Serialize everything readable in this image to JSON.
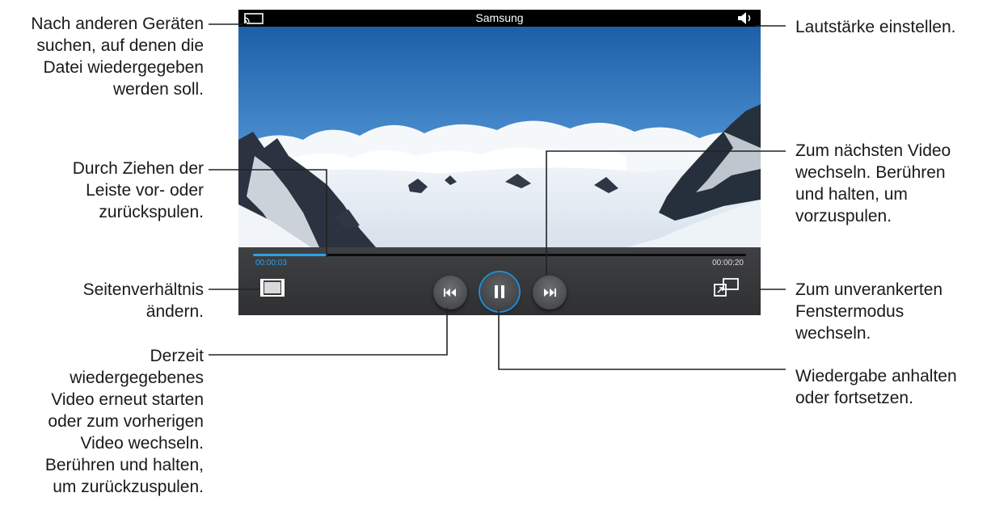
{
  "player": {
    "title": "Samsung",
    "time_current": "00:00:03",
    "time_total": "00:00:20",
    "progress": 0.15,
    "accent_color": "#2aa3e6",
    "icons": {
      "cast": "screen-mirroring-icon",
      "volume": "speaker-icon",
      "aspect": "aspect-ratio-icon",
      "previous": "skip-previous-icon",
      "pause": "pause-icon",
      "next": "skip-next-icon",
      "popup": "pop-up-window-icon"
    }
  },
  "callouts": {
    "devices": [
      "Nach anderen Geräten",
      "suchen, auf denen die",
      "Datei wiedergegeben",
      "werden soll."
    ],
    "scrub": [
      "Durch Ziehen der",
      "Leiste vor- oder",
      "zurückspulen."
    ],
    "aspect": [
      "Seitenverhältnis",
      "ändern."
    ],
    "previous": [
      "Derzeit",
      "wiedergegebenes",
      "Video erneut starten",
      "oder zum vorherigen",
      "Video wechseln.",
      "Berühren und halten,",
      "um zurückzuspulen."
    ],
    "volume": [
      "Lautstärke einstellen."
    ],
    "next": [
      "Zum nächsten Video",
      "wechseln. Berühren",
      "und halten, um",
      "vorzuspulen."
    ],
    "popup": [
      "Zum unverankerten",
      "Fenstermodus",
      "wechseln."
    ],
    "pause": [
      "Wiedergabe anhalten",
      "oder fortsetzen."
    ]
  }
}
